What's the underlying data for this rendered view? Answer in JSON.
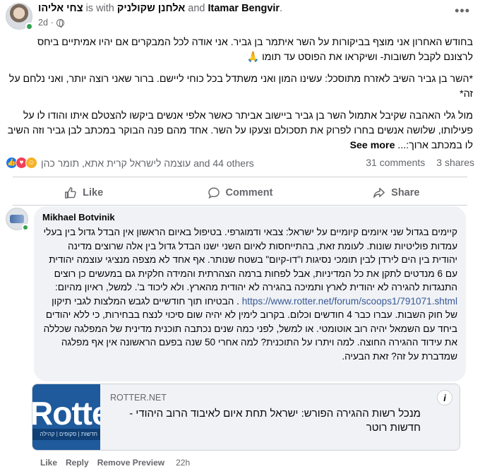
{
  "post": {
    "author": "צחי אליהו",
    "with_text": "is with",
    "tagged1": "אלחנן שקולניק",
    "and_text": "and",
    "tagged2": "Itamar Bengvir",
    "time": "2d",
    "more_icon": "ellipsis-icon",
    "privacy_icon": "globe-icon",
    "paragraphs": [
      "בחודש האחרון אני מוצף בביקורות על השר איתמר בן גביר. אני אודה לכל המבקרים אם יהיו אמיתיים ביחס לרצונם לקבל תשובות- ושיקראו את הפוסט עד תומו 🙏",
      "*השר בן גביר השיב לאזרח מתוסכל: עשינו המון ואני משתדל בכל כוחי ליישם. ברור שאני רוצה יותר, ואני נלחם על זה*",
      "מול גלי האהבה שקיבל אתמול השר בן גביר ביישוב אביתר כאשר אלפי אנשים ביקשו להצטלם איתו והודו לו על פעילותו, שלושה אנשים בחרו לפרוק את תסכולם וצעקו על השר. אחד מהם פנה הבוקר במכתב לבן גביר וזה השיב לו במכתב ארוך:..."
    ],
    "see_more": "See more"
  },
  "stats": {
    "reaction_names": "עוצמה לישראל קרית אתא, תומר כהן and 44 others",
    "comments": "31 comments",
    "shares": "3 shares"
  },
  "actions": {
    "like": "Like",
    "comment": "Comment",
    "share": "Share"
  },
  "comment": {
    "author": "Mikhael Botvinik",
    "text_before_link": "קיימים בגדול שני איומים קיומיים על ישראל: צבאי ודמוגרפי. בטיפול באיום הראשון אין הבדל גדול בין בעלי עמדות פוליטיות שונות. לעומת זאת, בהתייחסות לאיום השני ישנו הבדל גדול בין אלה שרוצים מדינה יהודית בין הים לירדן לבין תומכי נסיגות ו\"דו-קיום\" בשטח שנותר. אף אחד לא מצפה מנציגי עוצמה יהודית עם 6 מנדטים לתקן את כל המדיניות, אבל לפחות ברמה הצהרתית והמידה חלקית גם במעשים כן רוצים התנגדות להגירה לא יהודית לארץ ותמיכה בהגירה לא יהודית מהארץ. ולא ליכוד ב'. למשל, ראיון מהיום: ",
    "link": "https://www.rotter.net/forum/scoops1/791071.shtml",
    "text_after_link": " . הבטיחו תוך חודשיים לגבש המלצות לגבי תיקון של חוק השבות. עברו כבר 4 חודשים וכלום. בקרוב לימין לא יהיה שום סיכוי לנצח בבחירות, כי ללא יהודים ביחד עם השמאל יהיה רוב אוטומטי. או למשל, לפני כמה שנים נכתבה תוכנית מדינית של המפלגה שכללה את עידוד ההגירה החוצה. למה ויתרו על התוכנית? למה אחרי 50 שנה בפעם הראשונה אין אף מפלגה שמדברת על זה? זאת הבעיה.",
    "preview_domain": "ROTTER.NET",
    "preview_title": "מנכל רשות ההגירה הפורש: ישראל תחת איום לאיבוד הרוב היהודי - חדשות רוטר",
    "preview_thumb_word": "Rotter",
    "preview_thumb_strip": "חדשות | סקופים | קהילה",
    "info_icon": "i",
    "like": "Like",
    "reply": "Reply",
    "remove_preview": "Remove Preview",
    "time": "22h"
  },
  "colors": {
    "link": "#385898",
    "online": "#31a24c",
    "like_blue": "#1877f2",
    "love_red": "#f33e58",
    "care_yellow": "#f7b125"
  }
}
